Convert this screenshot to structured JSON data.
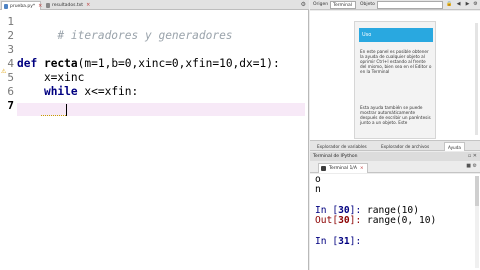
{
  "editor": {
    "tabs": [
      {
        "label": "prueba.py*",
        "close": "×"
      },
      {
        "label": "resultados.txt",
        "close": "×"
      }
    ],
    "line_numbers": [
      "1",
      "2",
      "3",
      "4",
      "5",
      "6",
      "7"
    ],
    "lines": {
      "l1_comment": "# iteradores y generadores",
      "l4_def": "def ",
      "l4_name": "recta",
      "l4_params": "(m=1,b=0,xinc=0,xfin=10,dx=1):",
      "l5": "    x=xinc",
      "l6_indent": "    ",
      "l6_kw": "while",
      "l6_rest": " x<=xfin:"
    }
  },
  "toolbar": {
    "source_label": "Origen",
    "source_value": "Terminal",
    "object_label": "Objeto"
  },
  "help": {
    "title": "Uso",
    "paragraph1": "En este panel es posible obtener la ayuda de cualquier objeto al oprimir Ctrl+I estando al frente del mismo, bien sea en el Editor o en la Terminal",
    "paragraph2": "Esta ayuda también se puede mostrar automáticamente después de escribir un paréntesis junto a un objeto. Este"
  },
  "pane_tabs": [
    "Explorador de variables",
    "Explorador de archivos",
    "Ayuda"
  ],
  "console": {
    "title": "Terminal de IPython",
    "tab_label": "Terminal 1/A",
    "tab_close": "×",
    "lines": {
      "l1": "o",
      "l2": "n",
      "in30_prompt": "In [",
      "in30_num": "30",
      "in30_end": "]: ",
      "in30_code": "range(10)",
      "out30_prompt": "Out[",
      "out30_num": "30",
      "out30_end": "]: ",
      "out30_value": "range(0, 10)",
      "in31_prompt": "In [",
      "in31_num": "31",
      "in31_end": "]: "
    }
  }
}
